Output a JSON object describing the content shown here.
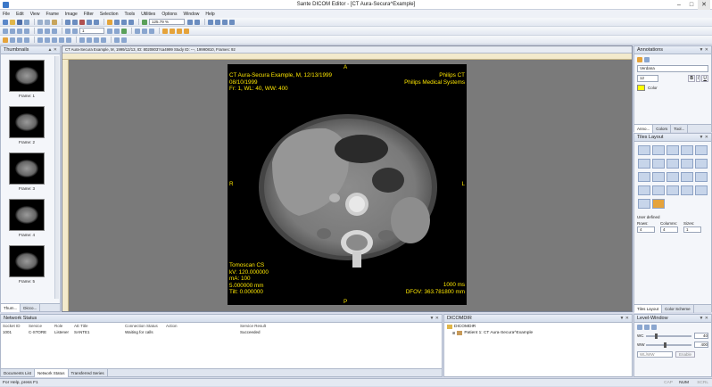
{
  "window": {
    "title": "Sante DICOM Editor - [CT Aura-Secura^Example]"
  },
  "menu": [
    "File",
    "Edit",
    "View",
    "Frame",
    "Image",
    "Filter",
    "Selection",
    "Tools",
    "Utilities",
    "Options",
    "Window",
    "Help"
  ],
  "toolbar": {
    "zoom": "125.79 %",
    "frame": "1"
  },
  "image_tab": {
    "info": "CT Aura-Secura Example, M, 1999/12/13, ID: 8020803?ca4999    Study ID: ---, 19990810, Frames: 92"
  },
  "thumbnails": {
    "title": "Thumbnails",
    "frames": [
      "Frame: 1",
      "Frame: 2",
      "Frame: 3",
      "Frame: 4",
      "Frame: 5"
    ],
    "tabs": [
      "Thum...",
      "Dicco..."
    ]
  },
  "overlay": {
    "top_marker": "A",
    "left_marker": "R",
    "right_marker": "L",
    "bottom_marker": "P",
    "tl": [
      "CT Aura-Secura Example, M, 12/13/1999",
      "08/10/1999",
      "Fr: 1, WL: 40, WW: 400"
    ],
    "tr": [
      "Philips CT",
      "Philips Medical Systems"
    ],
    "bl": [
      "Tomoscan CS",
      "kV: 120.000000",
      "mA:  100",
      "5.000000 mm",
      "Tilt: 0.000000"
    ],
    "br": [
      "1000 ms",
      "DFOV: 363.781800 mm"
    ]
  },
  "annotations": {
    "title": "Annotations",
    "font": "Verdana",
    "size": "12",
    "color_label": "Color",
    "tabs": [
      "Anno...",
      "Colors",
      "Tool..."
    ]
  },
  "tiles": {
    "title": "Tiles Layout",
    "user_defined": "User defined",
    "rows_label": "Rows:",
    "columns_label": "Columns:",
    "sizes_label": "Sizes:",
    "rows": "4",
    "columns": "4",
    "sizes": "1",
    "tabs": [
      "Tiles Layout",
      "Color Scheme"
    ]
  },
  "network": {
    "title": "Network Status",
    "columns": [
      "Socket ID",
      "Service",
      "Role",
      "AE Title",
      "Connection Status",
      "Action",
      "Service Result"
    ],
    "rows": [
      [
        "1001",
        "C-STORE",
        "Listener",
        "SANTE1",
        "Waiting for calls",
        "",
        "Succeeded"
      ]
    ],
    "tabs": [
      "Documents List",
      "Network Status",
      "Transferred Series"
    ]
  },
  "dicomdir": {
    "title": "DICOMDIR",
    "root": "DICOMDIR",
    "child": "Patient 1: CT Aura-Secura^Example"
  },
  "levelwindow": {
    "title": "Level-Window",
    "wl_label": "WC",
    "ww_label": "WW",
    "wl": "40",
    "ww": "400",
    "preset": "WL/WW",
    "button": "Enable"
  },
  "status": {
    "left": "For Help, press F1",
    "caps": "CAP",
    "num": "NUM",
    "scrl": "SCRL"
  }
}
